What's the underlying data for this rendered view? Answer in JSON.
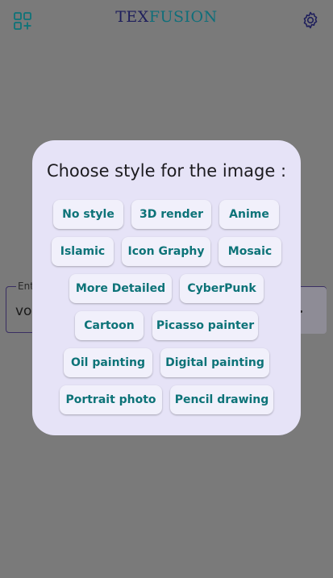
{
  "app": {
    "logo_part1": "TEX",
    "logo_part2": "FUSION"
  },
  "icons": {
    "left": "apps-add-icon",
    "right": "gear-icon"
  },
  "background": {
    "field_label": "Ent",
    "field_value": "vol"
  },
  "modal": {
    "title": "Choose style for the image :",
    "styles": [
      "No style",
      "3D render",
      "Anime",
      "Islamic",
      "Icon Graphy",
      "Mosaic",
      "More Detailed",
      "CyberPunk",
      "Cartoon",
      "Picasso painter",
      "Oil painting",
      "Digital painting",
      "Portrait photo",
      "Pencil drawing"
    ]
  },
  "colors": {
    "accent": "#0d7378",
    "modal_bg": "#e6e3f7",
    "chip_bg": "#f1f0fb",
    "overlay": "#7a7a7a"
  }
}
